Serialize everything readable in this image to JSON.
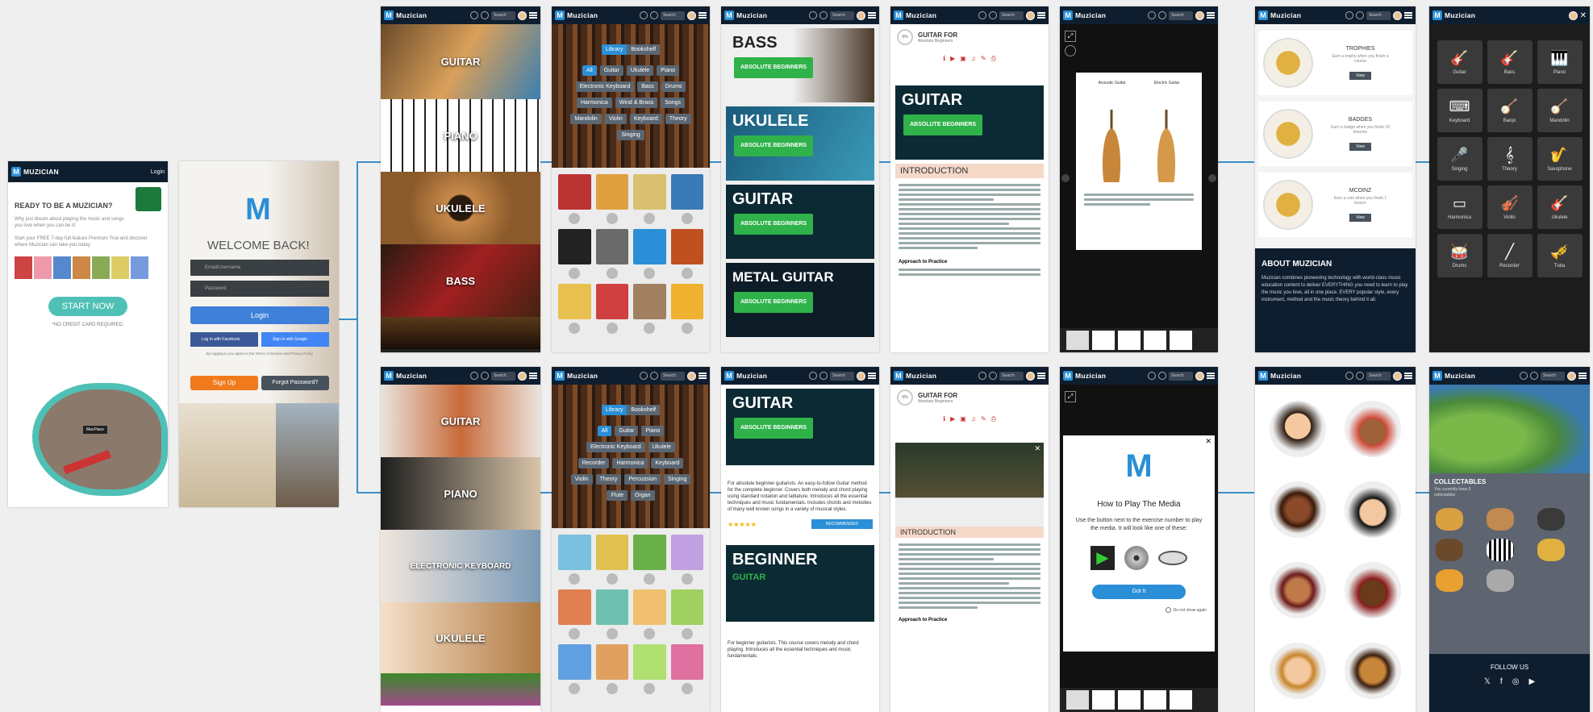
{
  "brand": "Muzician",
  "brand_upper": "MUZICIAN",
  "header_search": "Search",
  "colors": {
    "accent": "#2a8fd6",
    "header": "#0f1e2f",
    "teal": "#4fc0b6",
    "green": "#2fb24a",
    "orange": "#f07a1c"
  },
  "landing": {
    "login_link": "Login",
    "headline": "READY TO BE A MUZICIAN?",
    "body1": "Why just dream about playing the music and songs you love when you can be it!",
    "body2": "Start your FREE 7-day full-feature Premium Trial and discover where Muzician can take you today",
    "start_button": "START NOW",
    "no_card": "*NO CREDIT CARD REQUIRED.",
    "badge": "MacPlace"
  },
  "login": {
    "welcome": "WELCOME BACK!",
    "email_placeholder": "Email/Username",
    "password_placeholder": "Password",
    "login_button": "Login",
    "facebook_button": "Log in with Facebook",
    "google_button": "Sign in with Google",
    "terms": "By logging in you agree to the Terms of Service and Privacy Policy",
    "signup_button": "Sign Up",
    "forgot_button": "Forgot Password?"
  },
  "instruments_top": [
    "GUITAR",
    "PIANO",
    "UKULELE",
    "BASS"
  ],
  "instruments_bottom": [
    "GUITAR",
    "PIANO",
    "ELECTRONIC KEYBOARD",
    "UKULELE"
  ],
  "library": {
    "tabs": [
      "Library",
      "Bookshelf"
    ],
    "filters_top": [
      "All",
      "Guitar",
      "Ukulele",
      "Piano",
      "Electronic Keyboard",
      "Bass",
      "Drums",
      "Harmonica",
      "Wind & Brass",
      "Songs",
      "Mandolin",
      "Violin",
      "Keyboard",
      "Theory",
      "Singing"
    ],
    "filters_bottom": [
      "All",
      "Guitar",
      "Piano",
      "Electronic Keyboard",
      "Ukulele",
      "Recorder",
      "Harmonica",
      "Keyboard",
      "Violin",
      "Theory",
      "Percussion",
      "Singing",
      "Flute",
      "Organ"
    ]
  },
  "courses": {
    "top": [
      {
        "title": "BASS",
        "sub": "ABSOLUTE BEGINNERS"
      },
      {
        "title": "UKULELE",
        "sub": "ABSOLUTE BEGINNERS"
      },
      {
        "title": "GUITAR",
        "sub": "ABSOLUTE BEGINNERS"
      },
      {
        "title": "METAL GUITAR",
        "sub": "ABSOLUTE BEGINNERS"
      }
    ],
    "detail_title": "GUITAR",
    "detail_sub": "ABSOLUTE BEGINNERS",
    "detail_body": "For absolute beginner guitarists. An easy-to-follow Guitar method for the complete beginner. Covers both melody and chord playing using standard notation and tablature. Introduces all the essential techniques and music fundamentals. Includes chords and melodies of many well known songs in a variety of musical styles.",
    "detail_button": "RECOMMENDED",
    "stars": "★★★★★",
    "second_title": "BEGINNER",
    "second_sub": "GUITAR",
    "second_body": "For beginner guitarists. This course covers melody and chord playing. Introduces all the essential techniques and music fundamentals."
  },
  "reader": {
    "progress": "0%",
    "book_title": "GUITAR FOR",
    "book_sub": "Absolute Beginners",
    "cover_title": "GUITAR",
    "cover_sub": "ABSOLUTE BEGINNERS",
    "section": "INTRODUCTION",
    "approach": "Approach to Practice",
    "page_caption": "Acoustic Guitar",
    "page_caption2": "Electric Guitar"
  },
  "media_modal": {
    "title": "How to Play The Media",
    "body": "Use the button next to the exercise number to play the media. It will look like one of these:",
    "button": "Got It",
    "checkbox": "Do not show again"
  },
  "awards": [
    {
      "title": "TROPHIES",
      "desc": "Earn a trophy when you finish a course",
      "button": "View"
    },
    {
      "title": "BADGES",
      "desc": "Earn a badge when you finish 10 lessons",
      "button": "View"
    },
    {
      "title": "MCOINZ",
      "desc": "Earn a coin when you finish 1 lesson",
      "button": "View"
    }
  ],
  "about": {
    "title": "ABOUT MUZICIAN",
    "body": "Muzician combines pioneering technology with world-class music education content to deliver EVERYTHING you need to learn to play the music you love, all in one place. EVERY popular style, every instrument, method and the music theory behind it all."
  },
  "menu_tiles": [
    {
      "icon": "guitar-icon",
      "glyph": "🎸",
      "label": "Guitar"
    },
    {
      "icon": "bass-icon",
      "glyph": "🎸",
      "label": "Bass"
    },
    {
      "icon": "piano-icon",
      "glyph": "🎹",
      "label": "Piano"
    },
    {
      "icon": "keyboard-icon",
      "glyph": "⌨",
      "label": "Keyboard"
    },
    {
      "icon": "banjo-icon",
      "glyph": "🪕",
      "label": "Banjo"
    },
    {
      "icon": "mandolin-icon",
      "glyph": "🪕",
      "label": "Mandolin"
    },
    {
      "icon": "singing-icon",
      "glyph": "🎤",
      "label": "Singing"
    },
    {
      "icon": "theory-icon",
      "glyph": "𝄞",
      "label": "Theory"
    },
    {
      "icon": "saxophone-icon",
      "glyph": "🎷",
      "label": "Saxophone"
    },
    {
      "icon": "harmonica-icon",
      "glyph": "▭",
      "label": "Harmonica"
    },
    {
      "icon": "violin-icon",
      "glyph": "🎻",
      "label": "Violin"
    },
    {
      "icon": "ukulele-icon",
      "glyph": "🎸",
      "label": "Ukulele"
    },
    {
      "icon": "drums-icon",
      "glyph": "🥁",
      "label": "Drums"
    },
    {
      "icon": "recorder-icon",
      "glyph": "╱",
      "label": "Recorder"
    },
    {
      "icon": "tuba-icon",
      "glyph": "🎺",
      "label": "Tuba"
    }
  ],
  "collectables": {
    "title": "COLLECTABLES",
    "desc": "You currently have 0 collectables",
    "follow": "FOLLOW US",
    "social": [
      "twitter-icon",
      "facebook-icon",
      "instagram-icon",
      "youtube-icon"
    ],
    "social_glyphs": [
      "𝕏",
      "f",
      "◎",
      "▶"
    ]
  }
}
